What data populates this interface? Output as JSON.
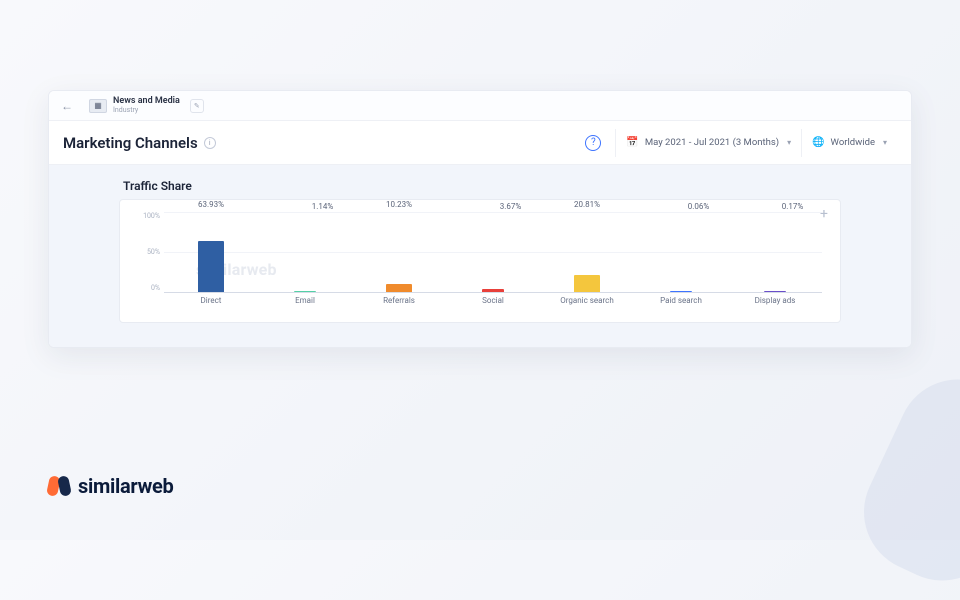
{
  "breadcrumb": {
    "title": "News and Media",
    "subtitle": "Industry"
  },
  "header": {
    "page_title": "Marketing Channels",
    "date_filter": "May 2021 - Jul 2021 (3 Months)",
    "region_filter": "Worldwide"
  },
  "chart_section_title": "Traffic Share",
  "watermark": "similarweb",
  "yaxis": {
    "t100": "100%",
    "t50": "50%",
    "t0": "0%"
  },
  "brand": "similarweb",
  "chart_data": {
    "type": "bar",
    "title": "Traffic Share",
    "xlabel": "",
    "ylabel": "",
    "ylim": [
      0,
      100
    ],
    "categories": [
      "Direct",
      "Email",
      "Referrals",
      "Social",
      "Organic search",
      "Paid search",
      "Display ads"
    ],
    "values": [
      63.93,
      1.14,
      10.23,
      3.67,
      20.81,
      0.06,
      0.17
    ],
    "value_labels": [
      "63.93%",
      "1.14%",
      "10.23%",
      "3.67%",
      "20.81%",
      "0.06%",
      "0.17%"
    ],
    "colors": [
      "#2f5fa3",
      "#55d0a6",
      "#f08b2c",
      "#e8403a",
      "#f4c63d",
      "#3e74ff",
      "#6a4fc9"
    ]
  }
}
